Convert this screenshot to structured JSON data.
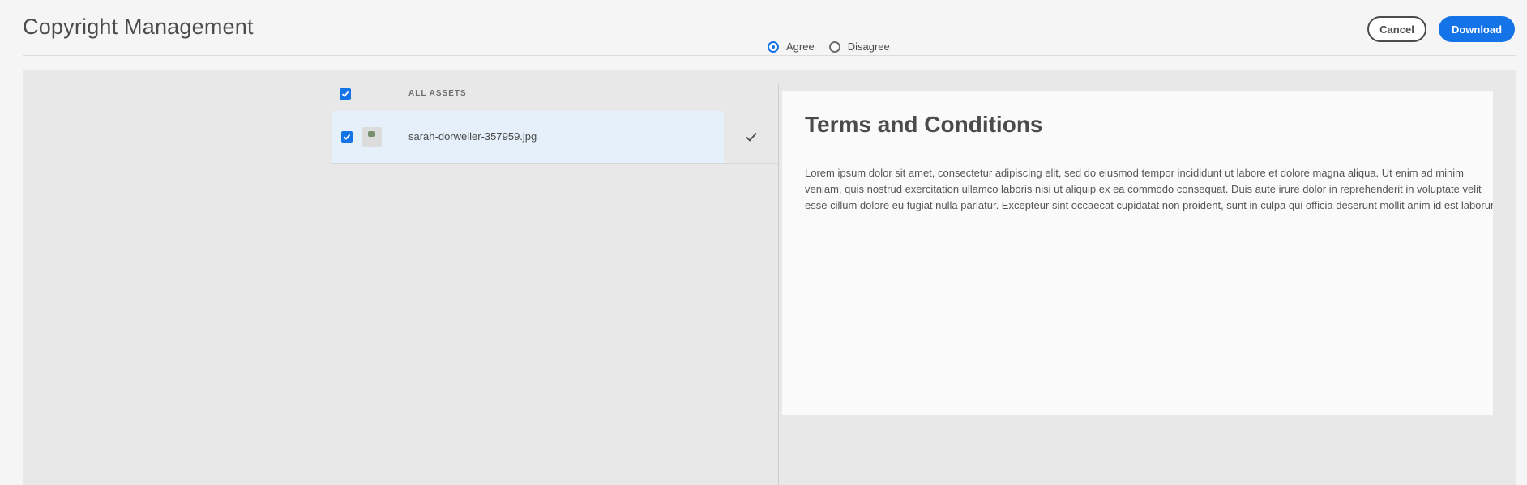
{
  "header": {
    "title": "Copyright Management",
    "cancel_label": "Cancel",
    "download_label": "Download"
  },
  "assets": {
    "header_label": "ALL ASSETS",
    "all_selected": true,
    "items": [
      {
        "name": "sarah-dorweiler-357959.jpg",
        "selected": true,
        "accepted": true
      }
    ]
  },
  "terms": {
    "options": [
      {
        "label": "Agree",
        "selected": true
      },
      {
        "label": "Disagree",
        "selected": false
      }
    ],
    "title": "Terms and Conditions",
    "body": "Lorem ipsum dolor sit amet, consectetur adipiscing elit, sed do eiusmod tempor incididunt ut labore et dolore magna aliqua. Ut enim ad minim veniam, quis nostrud exercitation ullamco laboris nisi ut aliquip ex ea commodo consequat. Duis aute irure dolor in reprehenderit in voluptate velit esse cillum dolore eu fugiat nulla pariatur. Excepteur sint occaecat cupidatat non proident, sunt in culpa qui officia deserunt mollit anim id est laborum"
  },
  "colors": {
    "accent": "#1473e6",
    "selected_row": "#e5f0fb",
    "panel": "#e8e8e8"
  }
}
